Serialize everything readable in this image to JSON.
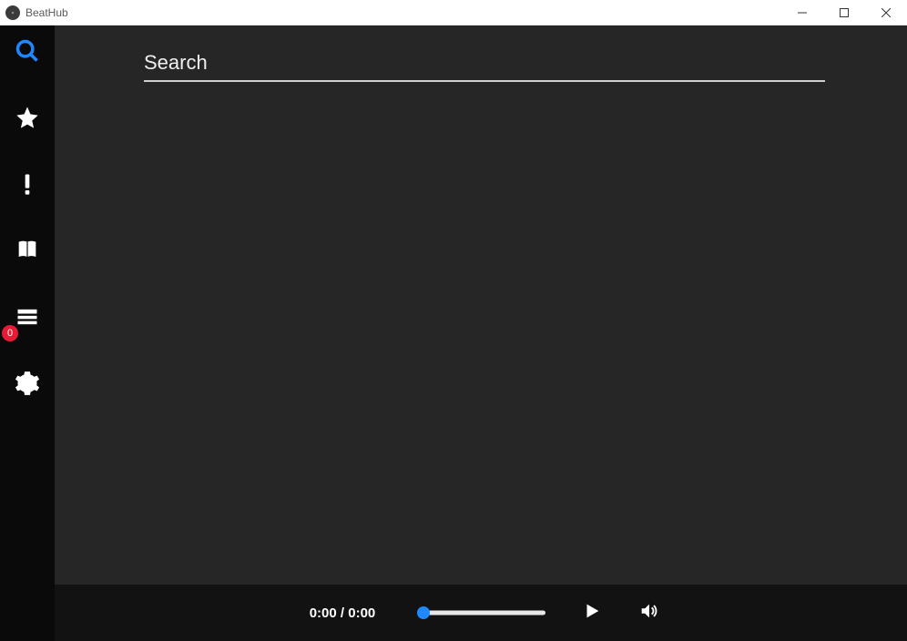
{
  "window": {
    "title": "BeatHub"
  },
  "sidebar": {
    "queue_badge": "0"
  },
  "search": {
    "placeholder": "Search"
  },
  "player": {
    "time_current": "0:00",
    "time_total": "0:00"
  }
}
